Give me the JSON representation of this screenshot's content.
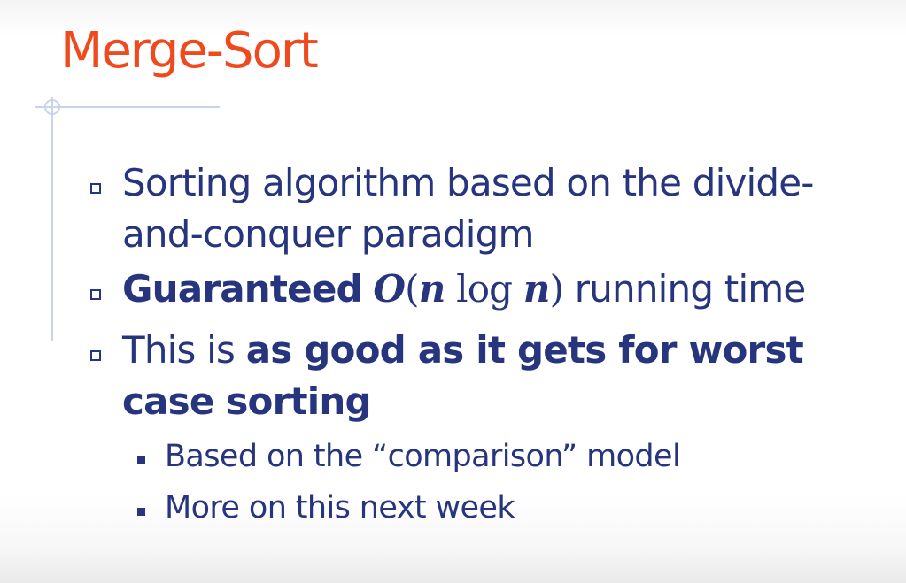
{
  "title": "Merge-Sort",
  "bullets": [
    {
      "line1": "Sorting algorithm based on the divide-",
      "line2": "and-conquer paradigm"
    },
    {
      "bold_lead": "Guaranteed",
      "math_O": "O",
      "math_open": "(",
      "math_n1": "n",
      "math_log": "log",
      "math_n2": "n",
      "math_close": ")",
      "rest": "running time"
    },
    {
      "lead": "This is",
      "bold_line1": "as good as it gets for worst",
      "bold_line2": "case sorting"
    }
  ],
  "subbullets": [
    "Based on the “comparison” model",
    "More on this next week"
  ],
  "colors": {
    "title": "#ef4a1d",
    "text": "#27347e",
    "decoration": "#c9d3ec"
  }
}
